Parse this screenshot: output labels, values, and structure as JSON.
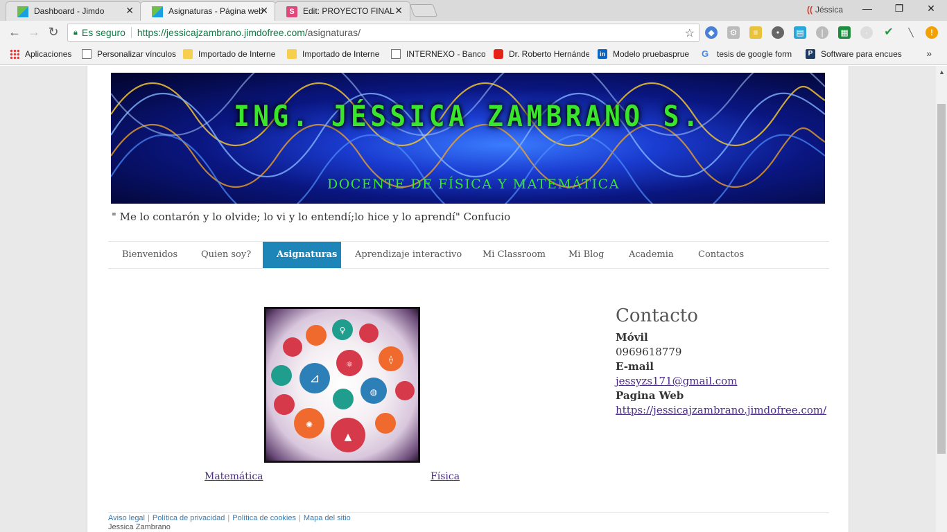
{
  "browser": {
    "tabs": [
      {
        "label": "Dashboard - Jimdo",
        "active": false
      },
      {
        "label": "Asignaturas - Página web",
        "active": true
      },
      {
        "label": "Edit: PROYECTO FINAL",
        "active": false
      }
    ],
    "profile_name": "Jéssica",
    "address": {
      "secure_label": "Es seguro",
      "host": "https://jessicajzambrano.jimdofree.com",
      "path": "/asignaturas/"
    },
    "bookmarks": [
      "Aplicaciones",
      "Personalizar vínculos",
      "Importado de Interne",
      "Importado de Interne",
      "INTERNEXO - Banco c",
      "Dr. Roberto Hernánde",
      "Modelo pruebasprue",
      "tesis de google form",
      "Software para encues"
    ],
    "bookmarks_more": "»"
  },
  "site": {
    "header_title": "ING. JÉSSICA ZAMBRANO S.",
    "header_subtitle": "DOCENTE DE FÍSICA  Y MATEMÁTICA",
    "quote": "\" Me lo contarón y lo olvide; lo vi y lo entendí;lo hice y lo aprendí\" Confucio",
    "nav": [
      {
        "label": "Bienvenidos",
        "active": false
      },
      {
        "label": "Quien soy?",
        "active": false
      },
      {
        "label": "Asignaturas",
        "active": true
      },
      {
        "label": "Aprendizaje interactivo",
        "active": false
      },
      {
        "label": "Mi Classroom",
        "active": false
      },
      {
        "label": "Mi Blog",
        "active": false
      },
      {
        "label": "Academia",
        "active": false
      },
      {
        "label": "Contactos",
        "active": false
      }
    ],
    "links": {
      "math": "Matemática",
      "physics": "Física"
    },
    "contact": {
      "heading": "Contacto",
      "mobile_label": "Móvil",
      "mobile": "0969618779",
      "email_label": "E-mail",
      "email": "jessyzs171@gmail.com",
      "web_label": "Pagina Web",
      "web": "https://jessicajzambrano.jimdofree.com/"
    },
    "footer": {
      "links": [
        "Aviso legal",
        "Política de privacidad",
        "Política de cookies",
        "Mapa del sitio"
      ],
      "owner": "Jessica Zambrano"
    }
  }
}
